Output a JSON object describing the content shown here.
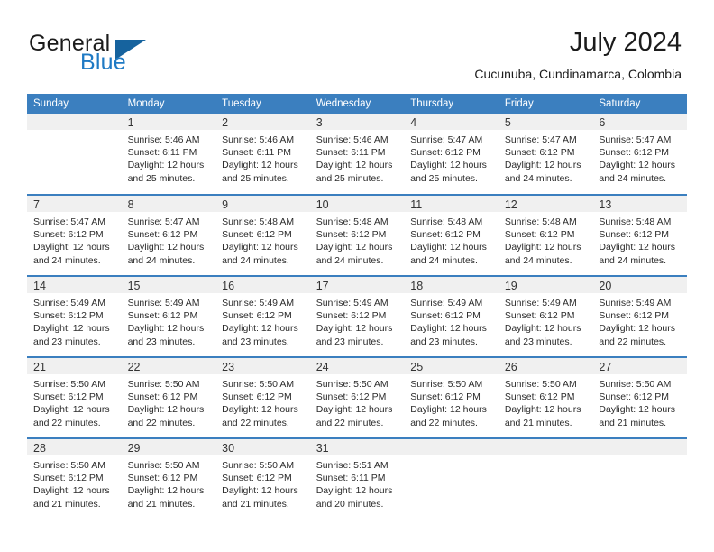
{
  "brand": {
    "name_top": "General",
    "name_bottom": "Blue",
    "accent_color": "#1f7ac4",
    "triangle_color": "#16639e"
  },
  "header": {
    "title": "July 2024",
    "subtitle": "Cucunuba, Cundinamarca, Colombia"
  },
  "theme": {
    "header_band": "#3b7fbf",
    "daynum_band": "#f0f0f0",
    "text": "#222222"
  },
  "weekdays": [
    "Sunday",
    "Monday",
    "Tuesday",
    "Wednesday",
    "Thursday",
    "Friday",
    "Saturday"
  ],
  "weeks": [
    [
      {
        "day": "",
        "l1": "",
        "l2": "",
        "l3": "",
        "l4": ""
      },
      {
        "day": "1",
        "l1": "Sunrise: 5:46 AM",
        "l2": "Sunset: 6:11 PM",
        "l3": "Daylight: 12 hours",
        "l4": "and 25 minutes."
      },
      {
        "day": "2",
        "l1": "Sunrise: 5:46 AM",
        "l2": "Sunset: 6:11 PM",
        "l3": "Daylight: 12 hours",
        "l4": "and 25 minutes."
      },
      {
        "day": "3",
        "l1": "Sunrise: 5:46 AM",
        "l2": "Sunset: 6:11 PM",
        "l3": "Daylight: 12 hours",
        "l4": "and 25 minutes."
      },
      {
        "day": "4",
        "l1": "Sunrise: 5:47 AM",
        "l2": "Sunset: 6:12 PM",
        "l3": "Daylight: 12 hours",
        "l4": "and 25 minutes."
      },
      {
        "day": "5",
        "l1": "Sunrise: 5:47 AM",
        "l2": "Sunset: 6:12 PM",
        "l3": "Daylight: 12 hours",
        "l4": "and 24 minutes."
      },
      {
        "day": "6",
        "l1": "Sunrise: 5:47 AM",
        "l2": "Sunset: 6:12 PM",
        "l3": "Daylight: 12 hours",
        "l4": "and 24 minutes."
      }
    ],
    [
      {
        "day": "7",
        "l1": "Sunrise: 5:47 AM",
        "l2": "Sunset: 6:12 PM",
        "l3": "Daylight: 12 hours",
        "l4": "and 24 minutes."
      },
      {
        "day": "8",
        "l1": "Sunrise: 5:47 AM",
        "l2": "Sunset: 6:12 PM",
        "l3": "Daylight: 12 hours",
        "l4": "and 24 minutes."
      },
      {
        "day": "9",
        "l1": "Sunrise: 5:48 AM",
        "l2": "Sunset: 6:12 PM",
        "l3": "Daylight: 12 hours",
        "l4": "and 24 minutes."
      },
      {
        "day": "10",
        "l1": "Sunrise: 5:48 AM",
        "l2": "Sunset: 6:12 PM",
        "l3": "Daylight: 12 hours",
        "l4": "and 24 minutes."
      },
      {
        "day": "11",
        "l1": "Sunrise: 5:48 AM",
        "l2": "Sunset: 6:12 PM",
        "l3": "Daylight: 12 hours",
        "l4": "and 24 minutes."
      },
      {
        "day": "12",
        "l1": "Sunrise: 5:48 AM",
        "l2": "Sunset: 6:12 PM",
        "l3": "Daylight: 12 hours",
        "l4": "and 24 minutes."
      },
      {
        "day": "13",
        "l1": "Sunrise: 5:48 AM",
        "l2": "Sunset: 6:12 PM",
        "l3": "Daylight: 12 hours",
        "l4": "and 24 minutes."
      }
    ],
    [
      {
        "day": "14",
        "l1": "Sunrise: 5:49 AM",
        "l2": "Sunset: 6:12 PM",
        "l3": "Daylight: 12 hours",
        "l4": "and 23 minutes."
      },
      {
        "day": "15",
        "l1": "Sunrise: 5:49 AM",
        "l2": "Sunset: 6:12 PM",
        "l3": "Daylight: 12 hours",
        "l4": "and 23 minutes."
      },
      {
        "day": "16",
        "l1": "Sunrise: 5:49 AM",
        "l2": "Sunset: 6:12 PM",
        "l3": "Daylight: 12 hours",
        "l4": "and 23 minutes."
      },
      {
        "day": "17",
        "l1": "Sunrise: 5:49 AM",
        "l2": "Sunset: 6:12 PM",
        "l3": "Daylight: 12 hours",
        "l4": "and 23 minutes."
      },
      {
        "day": "18",
        "l1": "Sunrise: 5:49 AM",
        "l2": "Sunset: 6:12 PM",
        "l3": "Daylight: 12 hours",
        "l4": "and 23 minutes."
      },
      {
        "day": "19",
        "l1": "Sunrise: 5:49 AM",
        "l2": "Sunset: 6:12 PM",
        "l3": "Daylight: 12 hours",
        "l4": "and 23 minutes."
      },
      {
        "day": "20",
        "l1": "Sunrise: 5:49 AM",
        "l2": "Sunset: 6:12 PM",
        "l3": "Daylight: 12 hours",
        "l4": "and 22 minutes."
      }
    ],
    [
      {
        "day": "21",
        "l1": "Sunrise: 5:50 AM",
        "l2": "Sunset: 6:12 PM",
        "l3": "Daylight: 12 hours",
        "l4": "and 22 minutes."
      },
      {
        "day": "22",
        "l1": "Sunrise: 5:50 AM",
        "l2": "Sunset: 6:12 PM",
        "l3": "Daylight: 12 hours",
        "l4": "and 22 minutes."
      },
      {
        "day": "23",
        "l1": "Sunrise: 5:50 AM",
        "l2": "Sunset: 6:12 PM",
        "l3": "Daylight: 12 hours",
        "l4": "and 22 minutes."
      },
      {
        "day": "24",
        "l1": "Sunrise: 5:50 AM",
        "l2": "Sunset: 6:12 PM",
        "l3": "Daylight: 12 hours",
        "l4": "and 22 minutes."
      },
      {
        "day": "25",
        "l1": "Sunrise: 5:50 AM",
        "l2": "Sunset: 6:12 PM",
        "l3": "Daylight: 12 hours",
        "l4": "and 22 minutes."
      },
      {
        "day": "26",
        "l1": "Sunrise: 5:50 AM",
        "l2": "Sunset: 6:12 PM",
        "l3": "Daylight: 12 hours",
        "l4": "and 21 minutes."
      },
      {
        "day": "27",
        "l1": "Sunrise: 5:50 AM",
        "l2": "Sunset: 6:12 PM",
        "l3": "Daylight: 12 hours",
        "l4": "and 21 minutes."
      }
    ],
    [
      {
        "day": "28",
        "l1": "Sunrise: 5:50 AM",
        "l2": "Sunset: 6:12 PM",
        "l3": "Daylight: 12 hours",
        "l4": "and 21 minutes."
      },
      {
        "day": "29",
        "l1": "Sunrise: 5:50 AM",
        "l2": "Sunset: 6:12 PM",
        "l3": "Daylight: 12 hours",
        "l4": "and 21 minutes."
      },
      {
        "day": "30",
        "l1": "Sunrise: 5:50 AM",
        "l2": "Sunset: 6:12 PM",
        "l3": "Daylight: 12 hours",
        "l4": "and 21 minutes."
      },
      {
        "day": "31",
        "l1": "Sunrise: 5:51 AM",
        "l2": "Sunset: 6:11 PM",
        "l3": "Daylight: 12 hours",
        "l4": "and 20 minutes."
      },
      {
        "day": "",
        "l1": "",
        "l2": "",
        "l3": "",
        "l4": ""
      },
      {
        "day": "",
        "l1": "",
        "l2": "",
        "l3": "",
        "l4": ""
      },
      {
        "day": "",
        "l1": "",
        "l2": "",
        "l3": "",
        "l4": ""
      }
    ]
  ]
}
